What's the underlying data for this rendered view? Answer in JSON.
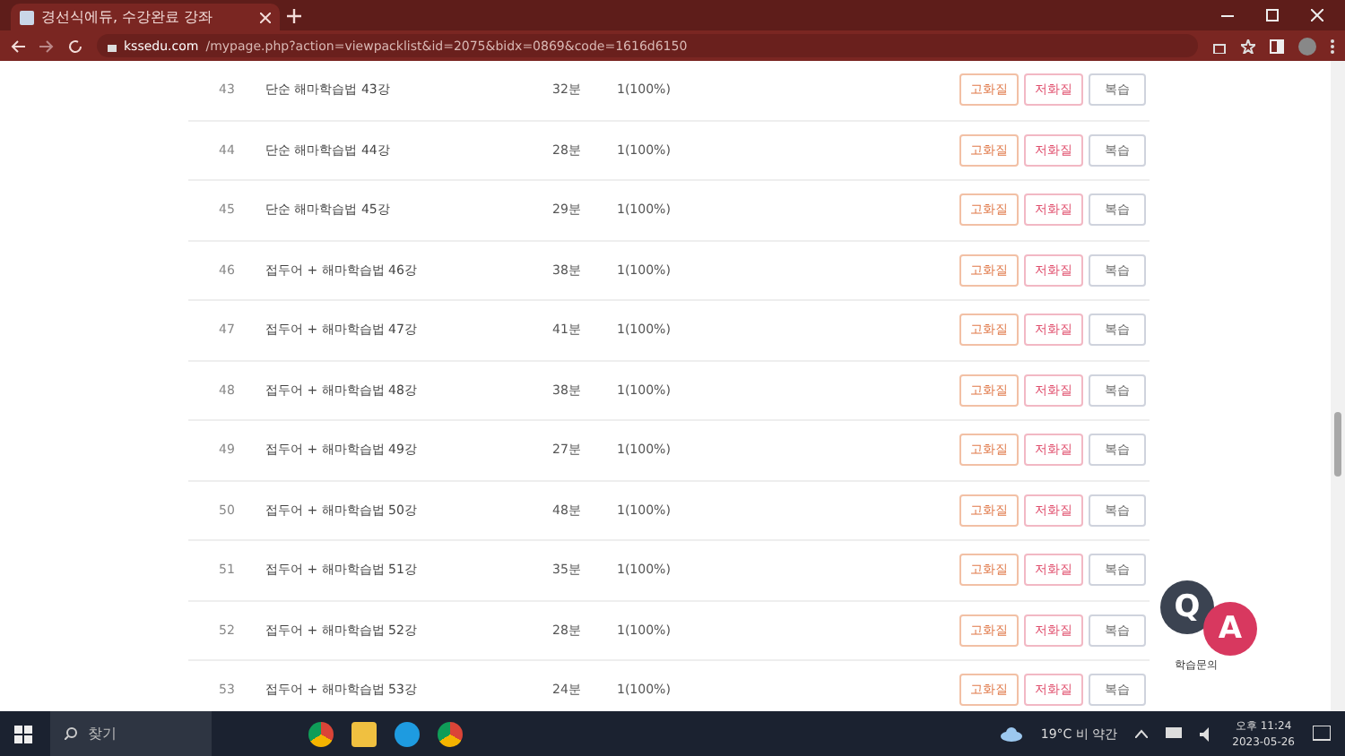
{
  "browser": {
    "tab_title": "경선식에듀, 수강완료 강좌",
    "url_host": "kssedu.com",
    "url_path": "/mypage.php?action=viewpacklist&id=2075&bidx=0869&code=1616d6150"
  },
  "lectures": [
    {
      "number": "43",
      "title": "단순 해마학습법 43강",
      "duration": "32분",
      "progress": "1(100%)",
      "buttons": [
        {
          "label": "고화질",
          "kind": "high"
        },
        {
          "label": "저화질",
          "kind": "low"
        },
        {
          "label": "복습",
          "kind": "review"
        }
      ]
    },
    {
      "number": "44",
      "title": "단순 해마학습법 44강",
      "duration": "28분",
      "progress": "1(100%)",
      "buttons": [
        {
          "label": "고화질",
          "kind": "high"
        },
        {
          "label": "저화질",
          "kind": "low"
        },
        {
          "label": "복습",
          "kind": "review"
        }
      ]
    },
    {
      "number": "45",
      "title": "단순 해마학습법 45강",
      "duration": "29분",
      "progress": "1(100%)",
      "buttons": [
        {
          "label": "고화질",
          "kind": "high"
        },
        {
          "label": "저화질",
          "kind": "low"
        },
        {
          "label": "복습",
          "kind": "review"
        }
      ]
    },
    {
      "number": "46",
      "title": "접두어 + 해마학습법 46강",
      "duration": "38분",
      "progress": "1(100%)",
      "buttons": [
        {
          "label": "고화질",
          "kind": "high"
        },
        {
          "label": "저화질",
          "kind": "low"
        },
        {
          "label": "복습",
          "kind": "review"
        }
      ]
    },
    {
      "number": "47",
      "title": "접두어 + 해마학습법 47강",
      "duration": "41분",
      "progress": "1(100%)",
      "buttons": [
        {
          "label": "고화질",
          "kind": "high"
        },
        {
          "label": "저화질",
          "kind": "low"
        },
        {
          "label": "복습",
          "kind": "review"
        }
      ]
    },
    {
      "number": "48",
      "title": "접두어 + 해마학습법 48강",
      "duration": "38분",
      "progress": "1(100%)",
      "buttons": [
        {
          "label": "고화질",
          "kind": "high"
        },
        {
          "label": "저화질",
          "kind": "low"
        },
        {
          "label": "복습",
          "kind": "review"
        }
      ]
    },
    {
      "number": "49",
      "title": "접두어 + 해마학습법 49강",
      "duration": "27분",
      "progress": "1(100%)",
      "buttons": [
        {
          "label": "고화질",
          "kind": "high"
        },
        {
          "label": "저화질",
          "kind": "low"
        },
        {
          "label": "복습",
          "kind": "review"
        }
      ]
    },
    {
      "number": "50",
      "title": "접두어 + 해마학습법 50강",
      "duration": "48분",
      "progress": "1(100%)",
      "buttons": [
        {
          "label": "고화질",
          "kind": "high"
        },
        {
          "label": "저화질",
          "kind": "low"
        },
        {
          "label": "복습",
          "kind": "review"
        }
      ]
    },
    {
      "number": "51",
      "title": "접두어 + 해마학습법 51강",
      "duration": "35분",
      "progress": "1(100%)",
      "buttons": [
        {
          "label": "고화질",
          "kind": "high"
        },
        {
          "label": "저화질",
          "kind": "low"
        },
        {
          "label": "복습",
          "kind": "review"
        }
      ]
    },
    {
      "number": "52",
      "title": "접두어 + 해마학습법 52강",
      "duration": "28분",
      "progress": "1(100%)",
      "buttons": [
        {
          "label": "고화질",
          "kind": "high"
        },
        {
          "label": "저화질",
          "kind": "low"
        },
        {
          "label": "복습",
          "kind": "review"
        }
      ]
    },
    {
      "number": "53",
      "title": "접두어 + 해마학습법 53강",
      "duration": "24분",
      "progress": "1(100%)",
      "buttons": [
        {
          "label": "고화질",
          "kind": "high"
        },
        {
          "label": "저화질",
          "kind": "low"
        },
        {
          "label": "복습",
          "kind": "review"
        }
      ]
    }
  ],
  "qa_badge": {
    "q": "Q",
    "a": "A",
    "caption": "학습문의"
  },
  "taskbar": {
    "search_placeholder": "찾기",
    "weather": "19°C 비 약간",
    "time": "오후 11:24",
    "date": "2023-05-26"
  }
}
